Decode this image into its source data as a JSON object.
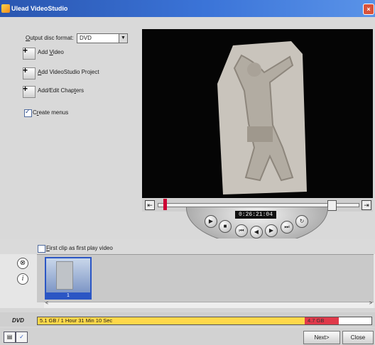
{
  "window": {
    "title": "Ulead VideoStudio",
    "close_glyph": "×"
  },
  "project": {
    "format_label_prefix": "O",
    "format_label_rest": "utput disc format:",
    "format_value": "DVD",
    "actions": [
      {
        "prefix": "Add ",
        "underline": "V",
        "rest": "ideo"
      },
      {
        "prefix": "",
        "underline": "A",
        "rest": "dd VideoStudio Project"
      },
      {
        "prefix": "Add/Edit Chap",
        "underline": "t",
        "rest": "ers"
      }
    ],
    "create_menus": {
      "prefix": "C",
      "underline": "r",
      "rest": "eate menus",
      "checked": true
    }
  },
  "player": {
    "timecode": "0:26:21:04",
    "transport_icons": [
      "play-icon",
      "stop-icon",
      "home-icon",
      "prev-frame-icon",
      "next-frame-icon",
      "end-icon",
      "repeat-icon"
    ]
  },
  "clips": {
    "first_clip_label_underline": "F",
    "first_clip_label_rest": "irst clip as first play video",
    "first_clip_checked": false,
    "thumbnail_index": "1",
    "side_icons": [
      "remove-clip-icon",
      "clip-info-icon"
    ]
  },
  "capacity": {
    "disc_label": "DVD",
    "used_text": "5.1 GB / 1 Hour 31 Min 10 Sec",
    "limit_text": "4.7 GB",
    "usage_fraction": 0.9
  },
  "footer": {
    "next_label": "Next>",
    "close_label": "Close"
  },
  "colors": {
    "titlebar": "#2a56b0",
    "capacity_fill": "#ffd84a",
    "capacity_overflow": "#e0394a",
    "selection": "#2b56c4"
  }
}
